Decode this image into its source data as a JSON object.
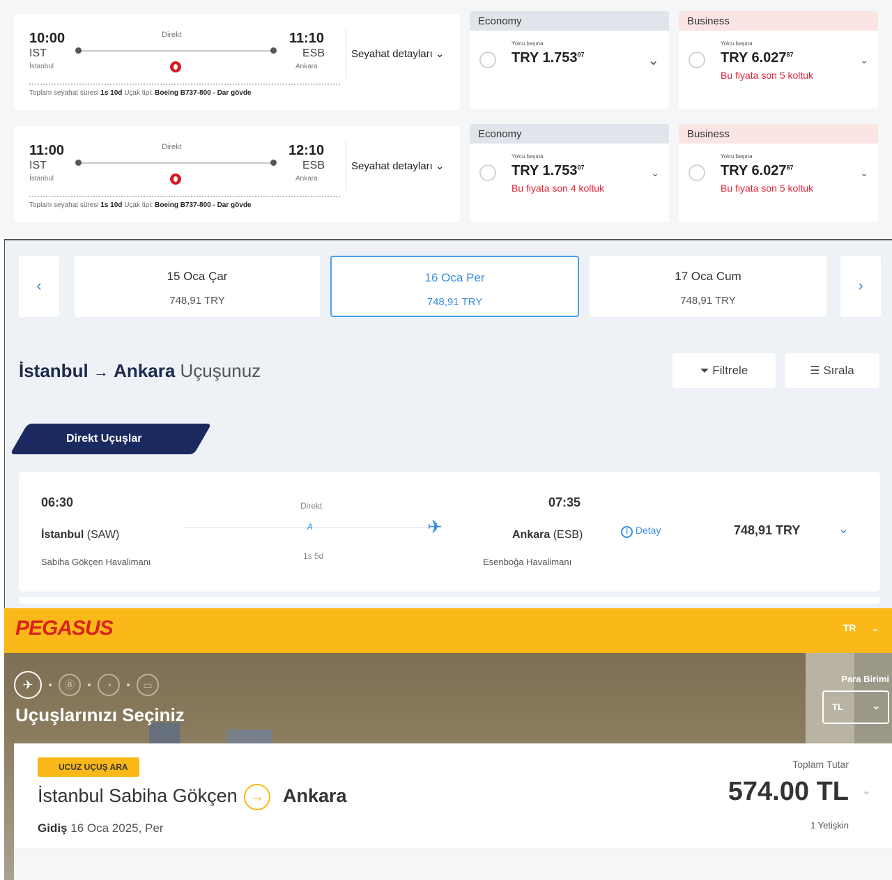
{
  "thy": {
    "flights": [
      {
        "dep_time": "10:00",
        "dep_code": "IST",
        "dep_city": "İstanbul",
        "arr_time": "11:10",
        "arr_code": "ESB",
        "arr_city": "Ankara",
        "stops": "Direkt",
        "meta_label": "Toplam seyahat süresi",
        "duration": "1s 10d",
        "plane_label": "Uçak tipi:",
        "plane": "Boeing B737-800 - Dar gövde",
        "details": "Seyahat detayları",
        "economy": {
          "label": "Economy",
          "per": "Yolcu başına",
          "price": "TRY 1.753",
          "cents": "07",
          "warning": ""
        },
        "business": {
          "label": "Business",
          "per": "Yolcu başına",
          "price": "TRY 6.027",
          "cents": "87",
          "warning": "Bu fiyata son 5 koltuk"
        }
      },
      {
        "dep_time": "11:00",
        "dep_code": "IST",
        "dep_city": "İstanbul",
        "arr_time": "12:10",
        "arr_code": "ESB",
        "arr_city": "Ankara",
        "stops": "Direkt",
        "meta_label": "Toplam seyahat süresi",
        "duration": "1s 10d",
        "plane_label": "Uçak tipi:",
        "plane": "Boeing B737-800 - Dar gövde",
        "details": "Seyahat detayları",
        "economy": {
          "label": "Economy",
          "per": "Yolcu başına",
          "price": "TRY 1.753",
          "cents": "07",
          "warning": "Bu fiyata son 4 koltuk"
        },
        "business": {
          "label": "Business",
          "per": "Yolcu başına",
          "price": "TRY 6.027",
          "cents": "87",
          "warning": "Bu fiyata son 5 koltuk"
        }
      }
    ]
  },
  "ajet": {
    "days": [
      {
        "date": "15 Oca Çar",
        "price": "748,91 TRY"
      },
      {
        "date": "16 Oca Per",
        "price": "748,91 TRY"
      },
      {
        "date": "17 Oca Cum",
        "price": "748,91 TRY"
      }
    ],
    "selected_day": 1,
    "route": {
      "from": "İstanbul",
      "arrow": "→",
      "to": "Ankara",
      "suffix": "Uçuşunuz"
    },
    "filter": "Filtrele",
    "sort": "Sırala",
    "tag": "Direkt Uçuşlar",
    "flight": {
      "dep_time": "06:30",
      "dep_city": "İstanbul",
      "dep_code": "(SAW)",
      "dep_airport": "Sabiha Gökçen Havalimanı",
      "stops": "Direkt",
      "duration": "1s 5d",
      "arr_time": "07:35",
      "arr_city": "Ankara",
      "arr_code": "(ESB)",
      "arr_airport": "Esenboğa Havalimanı",
      "detail": "Detay",
      "price": "748,91 TRY"
    },
    "accent": "#3a8fe0",
    "navy": "#1b2a5e"
  },
  "pegasus": {
    "logo": "PEGASUS",
    "lang": "TR",
    "heading": "Uçuşlarınızı Seçiniz",
    "currency_label": "Para Birimi",
    "currency": "TL",
    "badge": "UCUZ UÇUŞ ARA",
    "from": "İstanbul Sabiha Gökçen",
    "to": "Ankara",
    "date_label": "Gidiş",
    "date": "16 Oca 2025, Per",
    "total_label": "Toplam Tutar",
    "total": "574.00 TL",
    "pax": "1 Yetişkin",
    "brand_yellow": "#fbb819",
    "brand_red": "#d8241c"
  }
}
